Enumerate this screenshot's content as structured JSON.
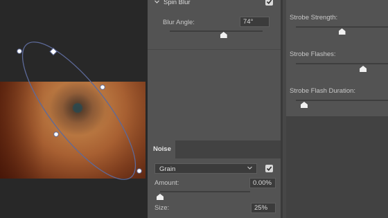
{
  "spin_blur": {
    "section_label": "Spin Blur",
    "enabled": true,
    "blur_angle_label": "Blur Angle:",
    "blur_angle_value": "74°",
    "blur_angle_fraction": 0.58
  },
  "strobe": {
    "strength_label": "Strobe Strength:",
    "strength_fraction": 0.5,
    "flashes_label": "Strobe Flashes:",
    "flashes_fraction": 0.73,
    "flash_duration_label": "Strobe Flash Duration:",
    "flash_duration_fraction": 0.09
  },
  "noise": {
    "tab_label": "Noise",
    "type_selected": "Grain",
    "enabled": true,
    "amount_label": "Amount:",
    "amount_value": "0.00%",
    "amount_fraction": 0.0,
    "size_label": "Size:",
    "size_value": "25%"
  },
  "colors": {
    "panel": "#535353",
    "canvas_bg": "#282828",
    "ellipse_stroke": "#5d6a9a",
    "thumb": "#f0f0f0"
  }
}
